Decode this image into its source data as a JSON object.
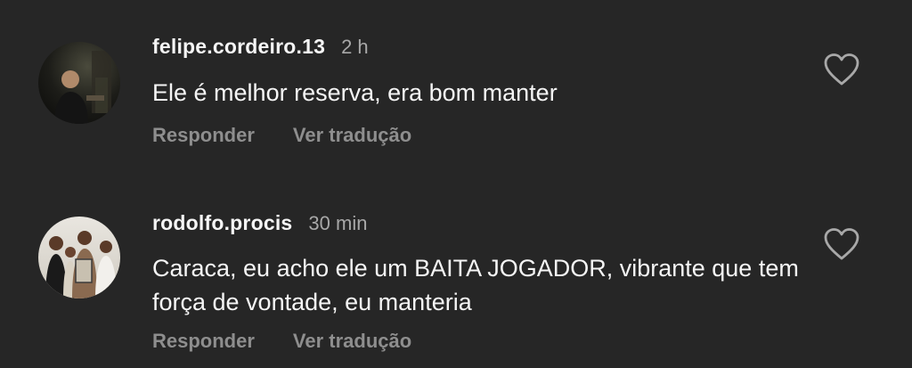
{
  "comments": [
    {
      "username": "felipe.cordeiro.13",
      "time": "2 h",
      "text": "Ele é melhor reserva, era bom manter",
      "reply_label": "Responder",
      "translate_label": "Ver tradução",
      "like_icon": "heart-outline-icon"
    },
    {
      "username": "rodolfo.procis",
      "time": "30 min",
      "text": "Caraca, eu acho ele um BAITA JOGADOR, vibrante que tem força de vontade, eu manteria",
      "reply_label": "Responder",
      "translate_label": "Ver tradução",
      "like_icon": "heart-outline-icon"
    }
  ],
  "colors": {
    "background": "#262626",
    "primary_text": "#f5f5f5",
    "secondary_text": "#a8a8a8",
    "action_text": "#8e8e8e"
  }
}
